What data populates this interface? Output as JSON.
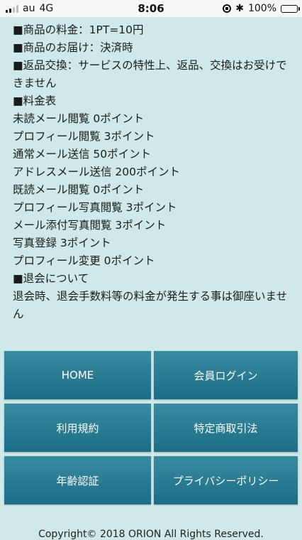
{
  "status_bar": {
    "carrier": "au",
    "network": "4G",
    "time": "8:06",
    "battery_percent": "100%",
    "bluetooth_glyph": "✱"
  },
  "content": {
    "lines": [
      "■商品の料金：1PT=10円",
      "■商品のお届け：決済時",
      "■返品交換：サービスの特性上、返品、交換はお受けできません",
      "■料金表",
      "未読メール閲覧 0ポイント",
      "プロフィール閲覧 3ポイント",
      "通常メール送信 50ポイント",
      "アドレスメール送信 200ポイント",
      "既読メール閲覧 0ポイント",
      "プロフィール写真閲覧 3ポイント",
      "メール添付写真閲覧 3ポイント",
      "写真登録 3ポイント",
      "プロフィール変更 0ポイント",
      "■退会について",
      "退会時、退会手数料等の料金が発生する事は御座いません"
    ]
  },
  "nav": {
    "home": "HOME",
    "member_login": "会員ログイン",
    "terms": "利用規約",
    "commerce_law": "特定商取引法",
    "age_verification": "年齢認証",
    "privacy_policy": "プライバシーポリシー"
  },
  "footer": {
    "copyright": "Copyright© 2018 ORION All Rights Reserved."
  },
  "colors": {
    "background": "#cfe8e9",
    "button_top": "#3a8aa0",
    "button_bottom": "#1c6d86"
  }
}
